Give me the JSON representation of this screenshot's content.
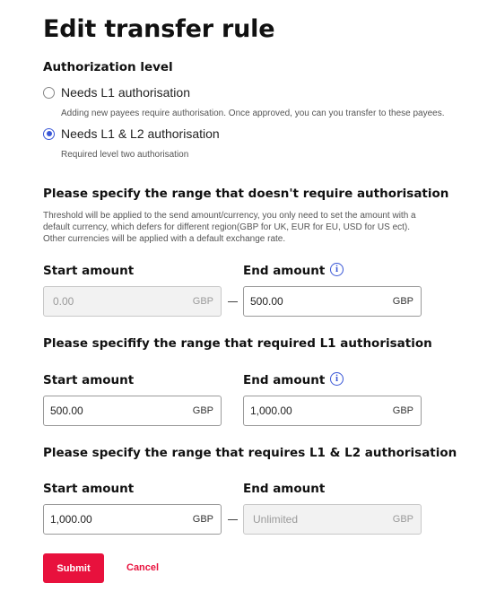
{
  "page": {
    "title": "Edit transfer rule"
  },
  "authorization": {
    "label": "Authorization level",
    "options": [
      {
        "label": "Needs L1 authorisation",
        "description": "Adding new payees require authorisation. Once approved, you can you transfer to these payees.",
        "selected": false
      },
      {
        "label": "Needs L1 & L2 authorisation",
        "description": "Required level two authorisation",
        "selected": true
      }
    ]
  },
  "sections": [
    {
      "title": "Please specify the range that doesn't require authorisation",
      "description": "Threshold will be applied to the send amount/currency, you only need to set the amount with a default currency, which defers for different region(GBP for UK, EUR for EU, USD for US ect). Other currencies will be applied with a default exchange rate.",
      "start_label": "Start amount",
      "end_label": "End amount",
      "start": {
        "value": "0.00",
        "currency": "GBP",
        "disabled": true
      },
      "end": {
        "value": "500.00",
        "currency": "GBP",
        "disabled": false
      }
    },
    {
      "title": "Please specifify the range that required L1 authorisation",
      "start_label": "Start amount",
      "end_label": "End amount",
      "start": {
        "value": "500.00",
        "currency": "GBP",
        "disabled": false
      },
      "end": {
        "value": "1,000.00",
        "currency": "GBP",
        "disabled": false
      }
    },
    {
      "title": "Please specify the range that requires L1 & L2 authorisation",
      "start_label": "Start amount",
      "end_label": "End amount",
      "start": {
        "value": "1,000.00",
        "currency": "GBP",
        "disabled": false
      },
      "end": {
        "value": "Unlimited",
        "currency": "GBP",
        "disabled": true
      }
    }
  ],
  "actions": {
    "submit_label": "Submit",
    "cancel_label": "Cancel"
  },
  "icons": {
    "info": "info-icon",
    "info_glyph": "i"
  },
  "colors": {
    "accent": "#3a57d6",
    "primary_button": "#e8113d",
    "cancel_text": "#e8113d"
  }
}
